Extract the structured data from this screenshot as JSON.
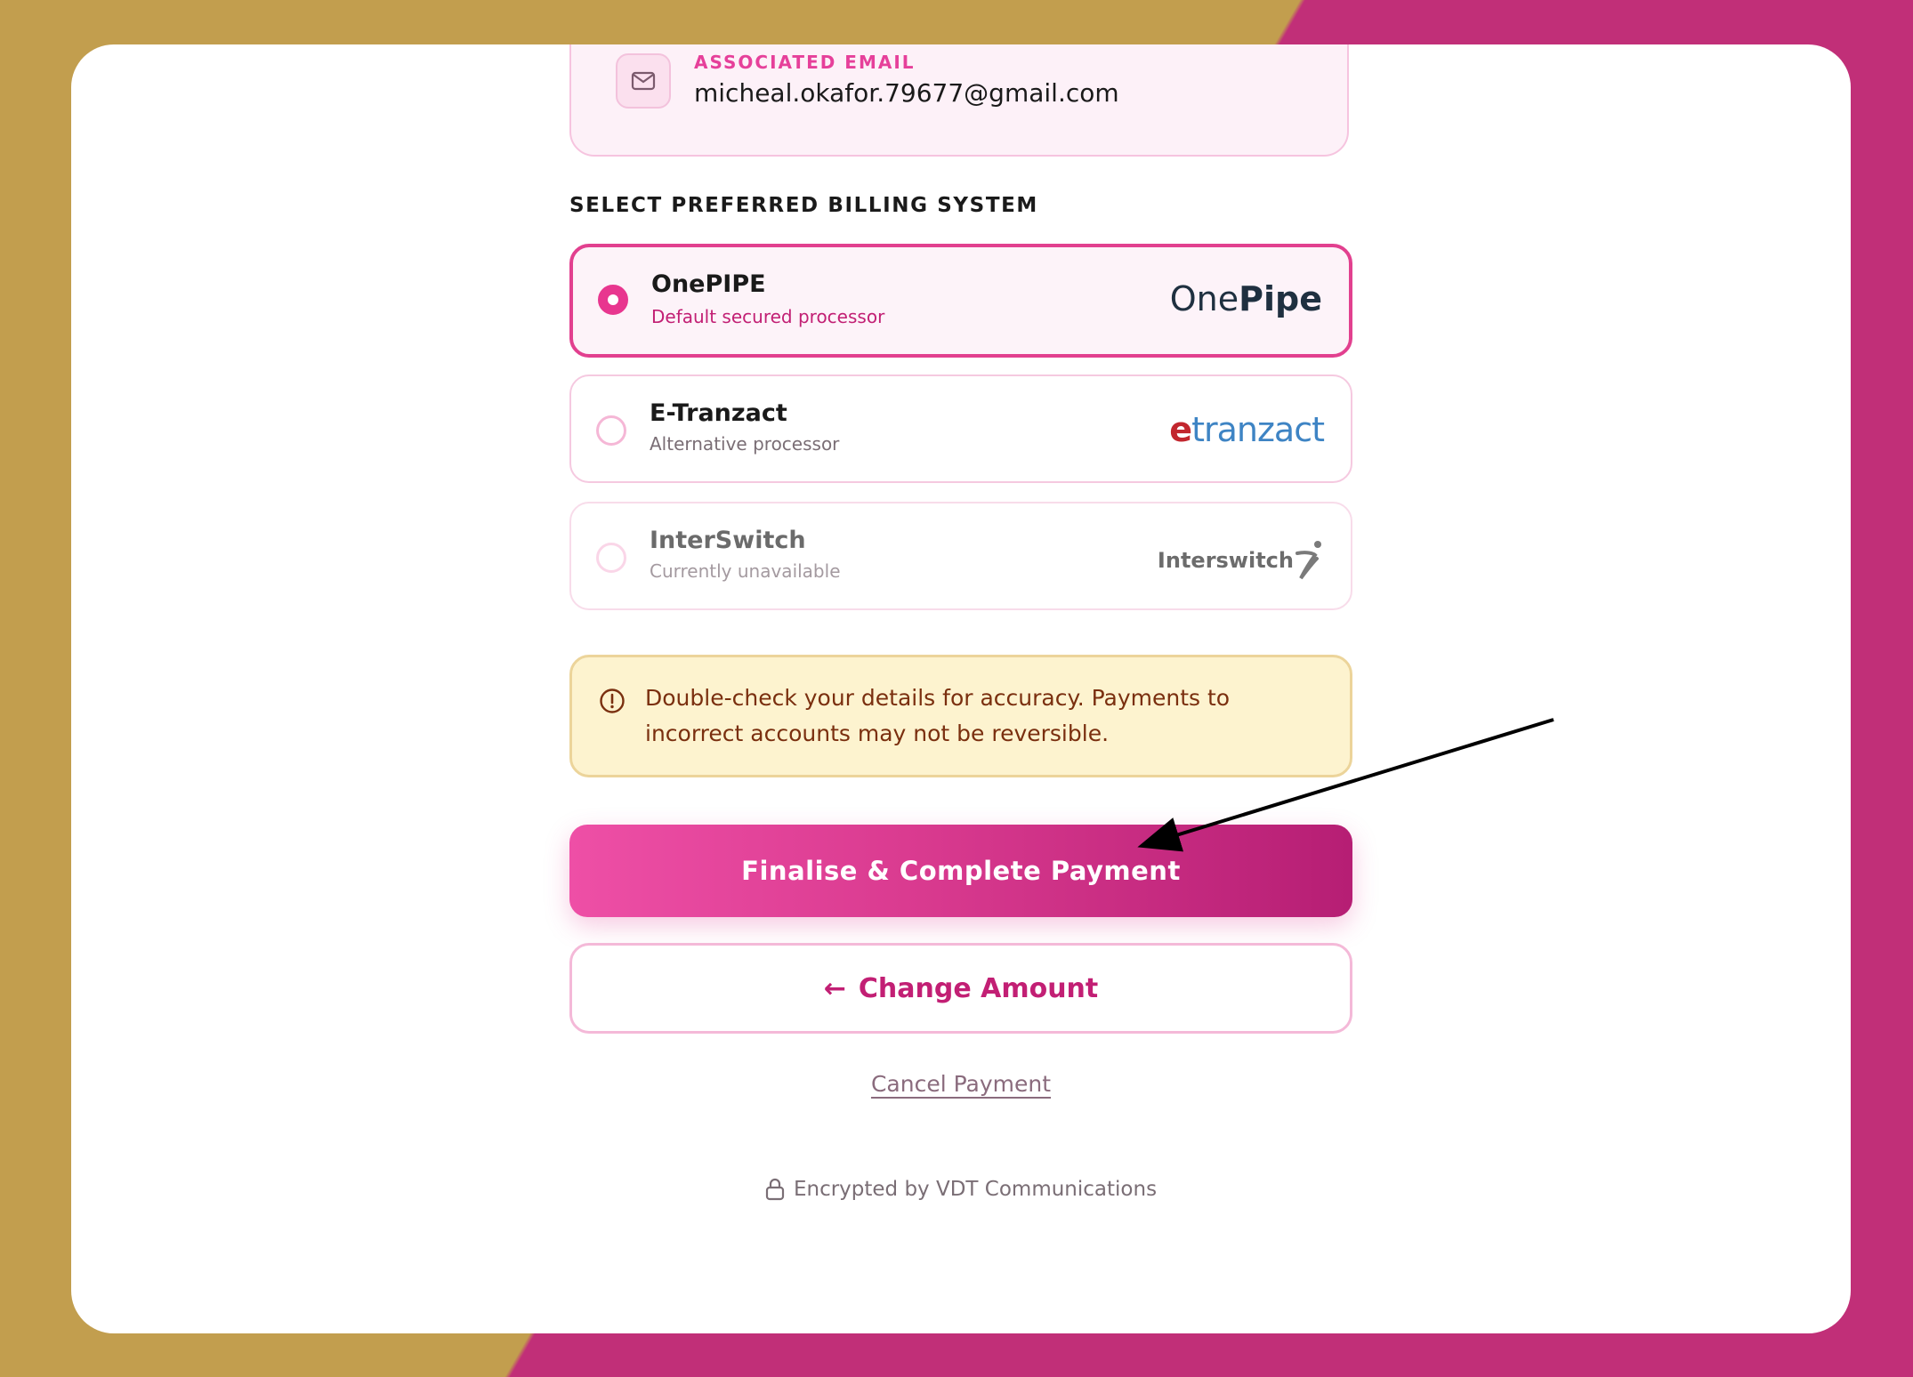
{
  "email": {
    "label": "ASSOCIATED EMAIL",
    "value": "micheal.okafor.79677@gmail.com",
    "icon": "mail-icon"
  },
  "billing": {
    "section_label": "SELECT PREFERRED BILLING SYSTEM",
    "options": [
      {
        "title": "OnePIPE",
        "subtitle": "Default secured processor",
        "logo_one": "One",
        "logo_pipe": "Pipe",
        "selected": true
      },
      {
        "title": "E-Tranzact",
        "subtitle": "Alternative processor",
        "logo_e": "e",
        "logo_rest": "tranzact",
        "selected": false
      },
      {
        "title": "InterSwitch",
        "subtitle": "Currently unavailable",
        "logo_text": "Interswitch",
        "selected": false,
        "disabled": true
      }
    ]
  },
  "warning": {
    "text": "Double-check your details for accuracy. Payments to incorrect accounts may not be reversible.",
    "icon": "alert-circle-icon"
  },
  "actions": {
    "primary_label": "Finalise & Complete Payment",
    "secondary_arrow": "←",
    "secondary_label": "Change Amount",
    "cancel_label": "Cancel Payment"
  },
  "footer": {
    "text": "Encrypted by VDT Communications",
    "icon": "lock-icon"
  },
  "colors": {
    "accent": "#e2408f",
    "accent_dark": "#b61e74",
    "background_gold": "#c29e4e",
    "background_magenta": "#c12f78",
    "warning_bg": "#fdf3cf"
  }
}
